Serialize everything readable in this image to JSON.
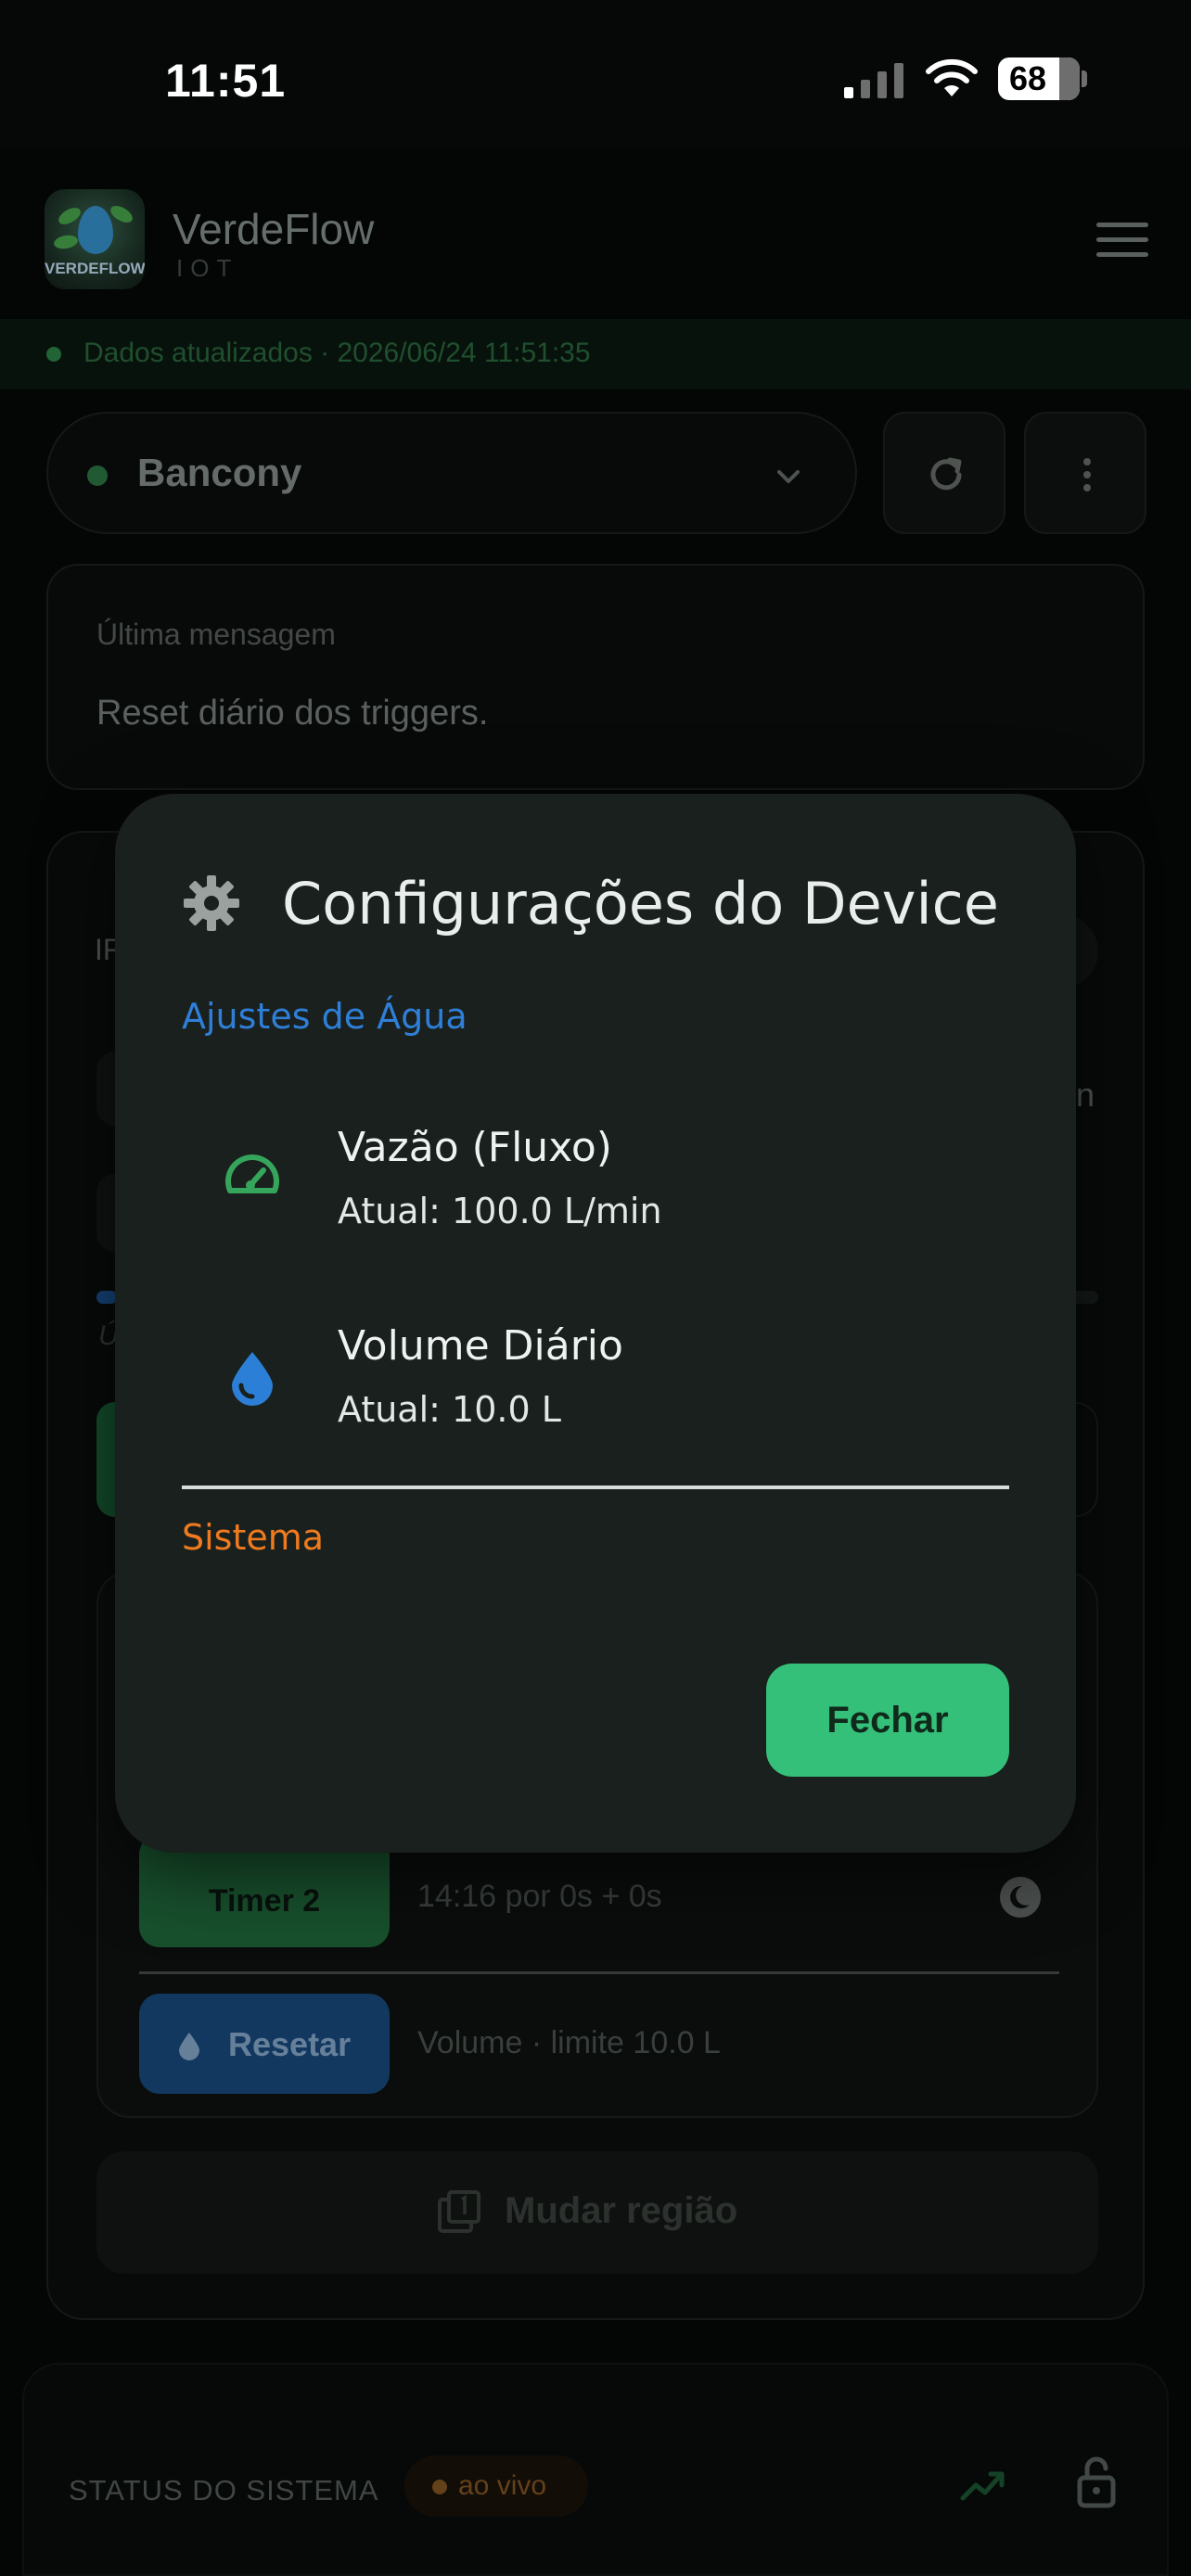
{
  "status_bar": {
    "time": "11:51",
    "battery": "68"
  },
  "header": {
    "app_name": "VerdeFlow",
    "app_sub": "IOT",
    "logo_word": "VERDEFLOW"
  },
  "banner": {
    "text": "Dados atualizados · 2026/06/24 11:51:35"
  },
  "device": {
    "name": "Bancony"
  },
  "last_message": {
    "label": "Última mensagem",
    "text": "Reset diário dos triggers."
  },
  "background": {
    "fragment_ir": "IR",
    "fragment_n": "n",
    "fragment_u": "Ú",
    "timer_label": "Timer 2",
    "timer_info": "14:16 por   0s +   0s",
    "reset_label": "Resetar",
    "reset_info": "Volume · limite 10.0 L",
    "region_label": "Mudar região"
  },
  "status_panel": {
    "title": "STATUS DO SISTEMA",
    "badge": "ao vivo"
  },
  "modal": {
    "title": "Configurações do Device",
    "section_water": "Ajustes de Água",
    "settings": [
      {
        "title": "Vazão (Fluxo)",
        "value": "Atual: 100.0 L/min",
        "icon": "speedometer-icon"
      },
      {
        "title": "Volume Diário",
        "value": "Atual: 10.0 L",
        "icon": "water-drop-icon"
      }
    ],
    "section_system": "Sistema",
    "close_label": "Fechar"
  },
  "colors": {
    "accent_green": "#35c07a",
    "water_blue": "#2f7fd8",
    "system_orange": "#ee7a1f",
    "modal_bg": "#19201d"
  }
}
